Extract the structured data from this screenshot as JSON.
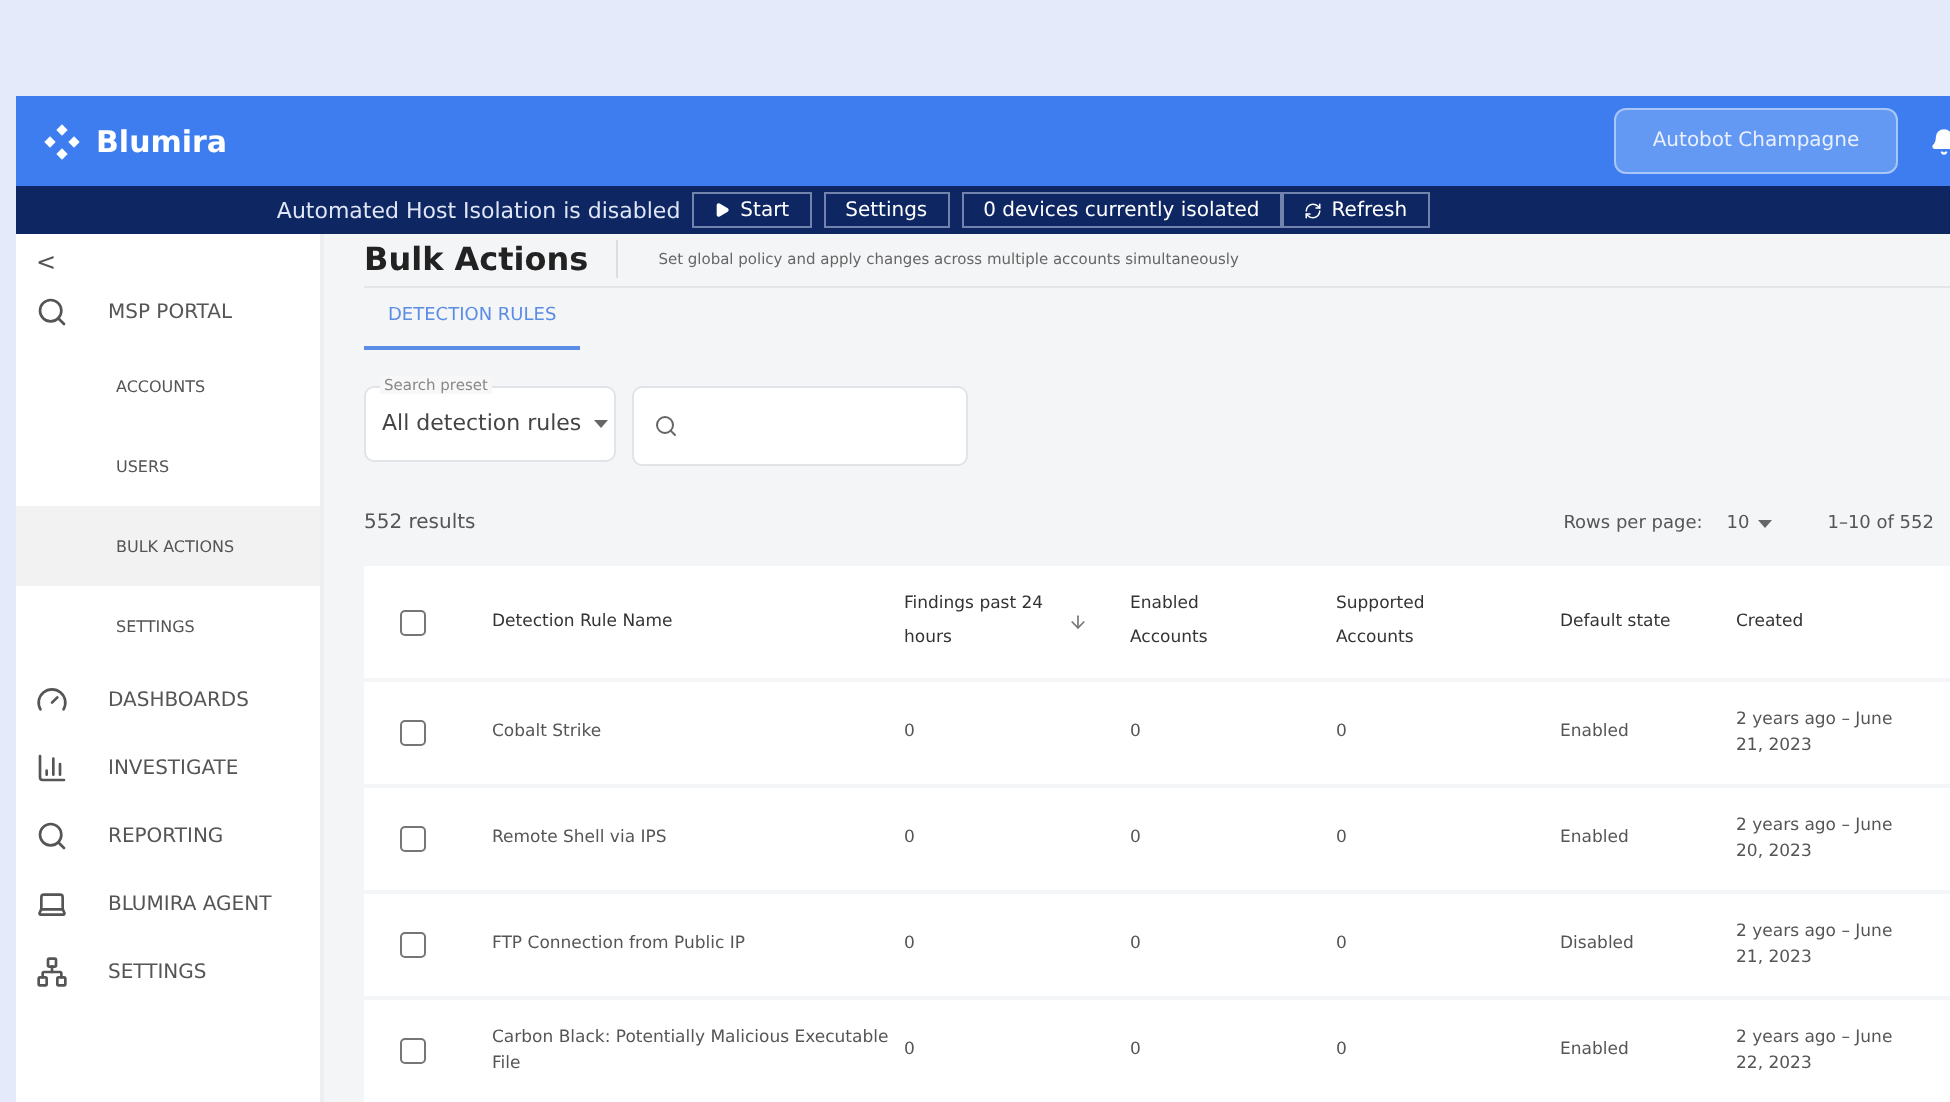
{
  "header": {
    "logo": "Blumira",
    "account": "Autobot Champagne"
  },
  "banner": {
    "message": "Automated Host Isolation is disabled",
    "start": "Start",
    "settings": "Settings",
    "isolated": "0 devices currently isolated",
    "refresh": "Refresh"
  },
  "sidebar": {
    "back": "<",
    "items": [
      {
        "label": "MSP PORTAL",
        "selected": false,
        "children": [
          {
            "label": "ACCOUNTS",
            "selected": false
          },
          {
            "label": "USERS",
            "selected": false
          },
          {
            "label": "BULK ACTIONS",
            "selected": true
          },
          {
            "label": "SETTINGS",
            "selected": false
          }
        ]
      },
      {
        "label": "DASHBOARDS",
        "selected": false
      },
      {
        "label": "INVESTIGATE",
        "selected": false
      },
      {
        "label": "REPORTING",
        "selected": false
      },
      {
        "label": "BLUMIRA AGENT",
        "selected": false
      },
      {
        "label": "SETTINGS",
        "selected": false
      }
    ]
  },
  "page": {
    "title": "Bulk Actions",
    "subtitle": "Set global policy and apply changes across multiple accounts simultaneously"
  },
  "tabs": [
    {
      "label": "DETECTION RULES",
      "selected": true
    }
  ],
  "filters": {
    "preset_label": "Search preset",
    "preset_value": "All detection rules"
  },
  "results": {
    "count": "552 results",
    "rows_per_page_label": "Rows per page:",
    "rows_per_page": "10",
    "range": "1–10 of 552"
  },
  "table": {
    "header_checked": false,
    "columns": [
      "Detection Rule Name",
      "Findings past 24 hours",
      "Enabled Accounts",
      "Supported Accounts",
      "Default state",
      "Created"
    ],
    "rows": [
      {
        "checked": false,
        "cells": [
          "Cobalt Strike",
          "0",
          "0",
          "0",
          "Enabled",
          "2 years ago – June 21, 2023"
        ]
      },
      {
        "checked": false,
        "cells": [
          "Remote Shell via IPS",
          "0",
          "0",
          "0",
          "Enabled",
          "2 years ago – June 20, 2023"
        ]
      },
      {
        "checked": false,
        "cells": [
          "FTP Connection from Public IP",
          "0",
          "0",
          "0",
          "Disabled",
          "2 years ago – June 21, 2023"
        ]
      },
      {
        "checked": false,
        "cells": [
          "Carbon Black: Potentially Malicious Executable File",
          "0",
          "0",
          "0",
          "Enabled",
          "2 years ago – June 22, 2023"
        ]
      }
    ]
  }
}
